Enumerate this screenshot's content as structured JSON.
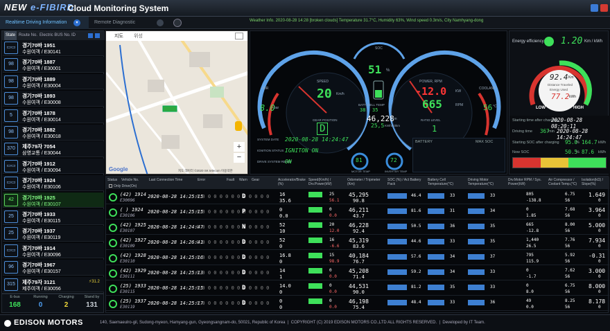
{
  "app": {
    "logo_new": "NEW",
    "logo_brand": "e-FIBIRD",
    "title": "Cloud Monitoring System"
  },
  "tabs": [
    {
      "label": "Realtime Driving Information"
    },
    {
      "label": "Remote Diagnostic"
    }
  ],
  "weather": "Weather Info. 2020-08-28 14:28 [broken clouds] Temperature 31.7°C, Humidity 63%, Wind speed 0.3m/s, City Namhyang-dong",
  "buslist": {
    "h_state": "State",
    "h_route": "Route No.",
    "h_bus": "Electric BUS No.",
    "h_id": "ID",
    "items": [
      {
        "icon": "bus-blue",
        "route": "1951",
        "name": "경기70바",
        "region": "수원여객",
        "id": "/ E30141"
      },
      {
        "icon": "98",
        "route": "1887",
        "name": "경기70바",
        "region": "수원여객",
        "id": "/ E30001"
      },
      {
        "icon": "98",
        "route": "1889",
        "name": "경기70바",
        "region": "수원여객",
        "id": "/ E30004"
      },
      {
        "icon": "98",
        "route": "1893",
        "name": "경기70바",
        "region": "수원여객",
        "id": "/ E30008"
      },
      {
        "icon": "5",
        "route": "1878",
        "name": "경기70바",
        "region": "수원여객",
        "id": "/ E30014"
      },
      {
        "icon": "98",
        "route": "1882",
        "name": "경기70바",
        "region": "수원여객",
        "id": "/ E30018"
      },
      {
        "icon": "370",
        "route": "7054",
        "name": "제주79자",
        "region": "삼영교통",
        "id": "/ E30044"
      },
      {
        "icon": "bus-blue",
        "route": "1912",
        "name": "경기70바",
        "region": "수원여객",
        "id": "/ E30094"
      },
      {
        "icon": "bus-blue",
        "route": "1924",
        "name": "경기70바",
        "region": "수원여객",
        "id": "/ E30106"
      },
      {
        "icon": "42",
        "route": "1925",
        "name": "경기70바",
        "region": "수원여객",
        "id": "/ E30107",
        "selected": true
      },
      {
        "icon": "25",
        "route": "1933",
        "name": "경기70바",
        "region": "수원여객",
        "id": "/ E30115"
      },
      {
        "icon": "25",
        "route": "1937",
        "name": "경기70바",
        "region": "수원여객",
        "id": "/ E30119"
      },
      {
        "icon": "bus-blue",
        "route": "1914",
        "name": "경기70바",
        "region": "수원여객",
        "id": "/ E30096"
      },
      {
        "icon": "96",
        "route": "1967",
        "name": "경기70바",
        "region": "수원여객",
        "id": "/ E30157"
      },
      {
        "icon": "315",
        "route": "3121",
        "name": "제주79자",
        "region": "제주여객",
        "id": "/ E30056",
        "charge": "31.2"
      }
    ]
  },
  "busstats": [
    {
      "label": "E-bus",
      "value": "168",
      "color": "#3ee05a"
    },
    {
      "label": "Running",
      "value": "0",
      "color": "#4d9df0"
    },
    {
      "label": "Charging",
      "value": "2",
      "color": "#f0d83a"
    },
    {
      "label": "Stand by",
      "value": "131",
      "color": "#c9cfd6"
    }
  ],
  "map": {
    "tab1": "지도",
    "tab2": "위성",
    "google": "Google",
    "credit": "지도 데이터 ©2020 SK telecom   이용약관"
  },
  "cluster": {
    "speed": "20",
    "speed_unit": "Km/h",
    "speed_label": "SPEED",
    "rpm_label": "POWER, RPM",
    "power": "-12.0",
    "power_unit": "KW",
    "rpm": "665",
    "rpm_unit": "RPM",
    "soc_label": "SOC",
    "soc": "51",
    "soc_unit": "%",
    "batt_label": "BATT. CELL TEMP",
    "batt_temp": "38",
    "batt_temp2": "35",
    "odo": "46,228",
    "odo_unit": "Km",
    "eco": "25,5",
    "eco_unit": "KWh/10km",
    "gear": "D",
    "gear_label": "GEAR POSITION",
    "gear2": "1",
    "gear2_label": "RATIO LEVEL",
    "air": "8.0",
    "air_unit": "bar",
    "air_label": "AIR",
    "cool": "56",
    "cool_unit": "°C",
    "cool_label": "COOLANT",
    "mini1": "81",
    "mini1_label": "MOTOR TEMP",
    "mini2": "72",
    "mini2_label": "INVERTER TEMP",
    "sysdate_label": "SYSTEM DATE",
    "sysdate": "2020-08-28 14:24:47",
    "ign_label": "IGNITION STATUS",
    "ign": "IGNITON ON",
    "drv_label": "DRIVE SYSTEM READY",
    "drv": "ON",
    "bat_label": "BATTERY",
    "bat_label2": "MAX SOC"
  },
  "efficiency": {
    "label": "Energy efficiency",
    "value": "1.20",
    "unit": "Km / kWh",
    "gauge_top": "92.4",
    "gauge_top_unit": "Km",
    "gauge_mid": "Distance Traveled",
    "gauge_mid2": "Energy Used",
    "gauge_bot": "77.2",
    "gauge_bot_unit": "kWh",
    "low": "LOW",
    "high": "HIGH",
    "start_label": "Starting time after charging",
    "start": "2020-08-28 08:20:11",
    "drive_label": "Driving time",
    "drive_min": "367",
    "drive_unit": "min",
    "drive_time": "2020-08-28 14:24:47",
    "soc_label": "Starting SOC after charging",
    "soc": "95.0",
    "soc_pct": "%",
    "soc_kwh": "164.7",
    "soc_kwh_unit": "kWh",
    "now_label": "Now SOC",
    "now": "50.5",
    "now_pct": "%",
    "now_kwh": "87.6",
    "now_kwh_unit": "kWh"
  },
  "table": {
    "headers": [
      "Status",
      "Vehicle No.",
      "Last Connection Time",
      "Error",
      "Fault",
      "Warn",
      "Gear",
      "Accelerator/Brake (%)",
      "Speed(Km/h) / Drv.Power(kW)",
      "Odometer / Tripmeter (Km)",
      "SOC (%) / Act Battery Pack",
      "Battery Cell Temperature(°C)",
      "Driving Motor Temperature(°C)",
      "Drv.Motor RPM / Sys. Power(kW)",
      "Air Compressor / Coolant Temp.(°C)",
      "Isolation(kΩ) / Slope(%)"
    ],
    "filter": "Only Drive(On)",
    "rows": [
      {
        "veh": "(42) 1914",
        "id": "E30096",
        "time": "2020-08-28 14:25:15",
        "gear": "D",
        "acc": "16",
        "brk": "35.6",
        "spd": "25",
        "pwr": "56.1",
        "odo": "45,295",
        "trip": "90.8",
        "soc": "46.4",
        "batt": "33",
        "mot": "33",
        "rpm": "805",
        "sp": "-138.8",
        "air": "6.75",
        "cool": "56",
        "iso": "1.649",
        "slope": "0"
      },
      {
        "veh": "( ) 1924",
        "id": "E30106",
        "time": "2020-08-28 14:25:15",
        "gear": "P",
        "acc": "0",
        "brk": "0.0",
        "spd": "0",
        "pwr": "0.0",
        "odo": "46,211",
        "trip": "43.7",
        "soc": "81.6",
        "batt": "31",
        "mot": "34",
        "rpm": "0",
        "sp": "1.85",
        "air": "7.68",
        "cool": "56",
        "iso": "3.964",
        "slope": "0"
      },
      {
        "veh": "(42) 1925",
        "id": "E30107",
        "time": "2020-08-28 14:24:47",
        "gear": "N",
        "acc": "52",
        "brk": "10",
        "spd": "20",
        "pwr": "12.0",
        "odo": "46,228",
        "trip": "92.4",
        "soc": "50.5",
        "batt": "36",
        "mot": "35",
        "rpm": "665",
        "sp": "-12.8",
        "air": "8.00",
        "cool": "56",
        "iso": "5.000",
        "slope": "0"
      },
      {
        "veh": "(42) 1927",
        "id": "E30109",
        "time": "2020-08-28 14:26:41",
        "gear": "D",
        "acc": "52",
        "brk": "0",
        "spd": "16",
        "pwr": "-6.6",
        "odo": "45,319",
        "trip": "83.6",
        "soc": "44.6",
        "batt": "33",
        "mot": "35",
        "rpm": "1,440",
        "sp": "26.5",
        "air": "7.76",
        "cool": "56",
        "iso": "7.934",
        "slope": "0"
      },
      {
        "veh": "(42) 1928",
        "id": "E30110",
        "time": "2020-08-28 14:25:16",
        "gear": "D",
        "acc": "16.8",
        "brk": "0",
        "spd": "15",
        "pwr": "98.9",
        "odo": "40,184",
        "trip": "76.7",
        "soc": "57.6",
        "batt": "34",
        "mot": "37",
        "rpm": "795",
        "sp": "115.9",
        "air": "5.92",
        "cool": "56",
        "iso": "-0.31",
        "slope": "0"
      },
      {
        "veh": "(42) 1929",
        "id": "E30111",
        "time": "2020-08-28 14:25:13",
        "gear": "D",
        "acc": "14",
        "brk": "1",
        "spd": "0",
        "pwr": "0.0",
        "odo": "45,208",
        "trip": "71.4",
        "soc": "59.2",
        "batt": "34",
        "mot": "33",
        "rpm": "0",
        "sp": "-1.7",
        "air": "7.62",
        "cool": "56",
        "iso": "3.000",
        "slope": "0"
      },
      {
        "veh": "(25) 1933",
        "id": "E30115",
        "time": "2020-08-28 14:25:15",
        "gear": "D",
        "acc": "14.0",
        "brk": "0",
        "spd": "0",
        "pwr": "0.0",
        "odo": "44,531",
        "trip": "90.0",
        "soc": "81.2",
        "batt": "35",
        "mot": "33",
        "rpm": "0",
        "sp": "8.0",
        "air": "6.75",
        "cool": "56",
        "iso": "8.000",
        "slope": "0"
      },
      {
        "veh": "(25) 1937",
        "id": "E30119",
        "time": "2020-08-28 14:25:17",
        "gear": "D",
        "acc": "0",
        "brk": "0",
        "spd": "0",
        "pwr": "0.0",
        "odo": "46,198",
        "trip": "75.4",
        "soc": "48.4",
        "batt": "33",
        "mot": "36",
        "rpm": "49",
        "sp": "0.0",
        "air": "8.25",
        "cool": "56",
        "iso": "8.178",
        "slope": "0"
      }
    ]
  },
  "footer": {
    "brand": "EDISON MOTORS",
    "address": "140, Saemaeulro-gil, Sudong-myeon, Hamyang-gun, Gyeongsangnam-do, 50021, Republic of Korea",
    "copyright": "COPYRIGHT (C) 2019 EDISON MOTORS CO.,LTD ALL RIGHTS RESERVED.",
    "dev": "Developed by IT Team."
  }
}
